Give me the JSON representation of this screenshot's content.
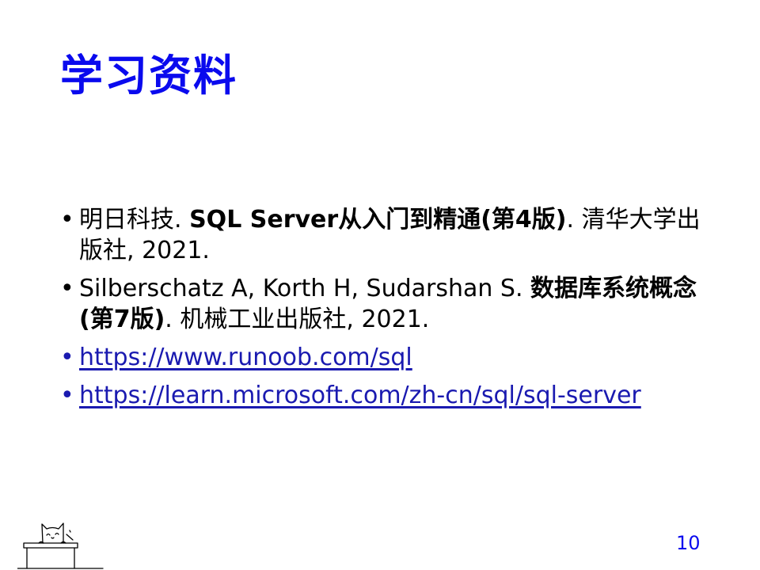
{
  "slide": {
    "title": "学习资料",
    "page_number": "10"
  },
  "references": [
    {
      "author": "明日科技. ",
      "title": "SQL Server从入门到精通(第4版)",
      "rest": ". 清华大学出版社, 2021."
    },
    {
      "author": "Silberschatz A, Korth H, Sudarshan S. ",
      "title": "数据库系统概念(第7版)",
      "rest": ". 机械工业出版社, 2021."
    }
  ],
  "links": [
    {
      "text": "https://www.runoob.com/sql"
    },
    {
      "text": "https://learn.microsoft.com/zh-cn/sql/sql-server"
    }
  ],
  "colors": {
    "title": "#0a0aee",
    "link": "#1a1ab0",
    "text": "#000000"
  },
  "icons": {
    "bullet": "•",
    "mascot": "cat-at-desk-icon"
  }
}
